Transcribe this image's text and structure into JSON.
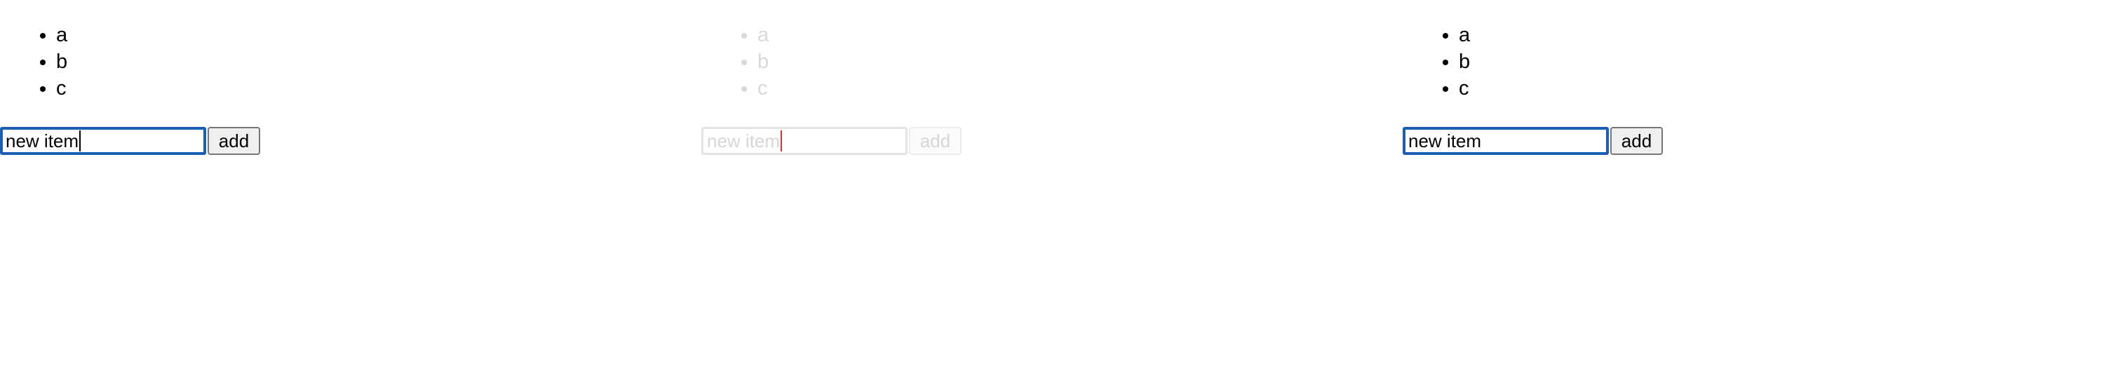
{
  "panels": [
    {
      "items": [
        "a",
        "b",
        "c"
      ],
      "input_value": "new item",
      "button_label": "add"
    },
    {
      "items": [
        "a",
        "b",
        "c"
      ],
      "input_value": "new item",
      "button_label": "add"
    },
    {
      "items": [
        "a",
        "b",
        "c"
      ],
      "input_value": "new item",
      "button_label": "add"
    }
  ],
  "colors": {
    "focus_border": "#1a5fb4",
    "faded_text": "#d9d9d9",
    "faded_caret": "#e0302a"
  }
}
